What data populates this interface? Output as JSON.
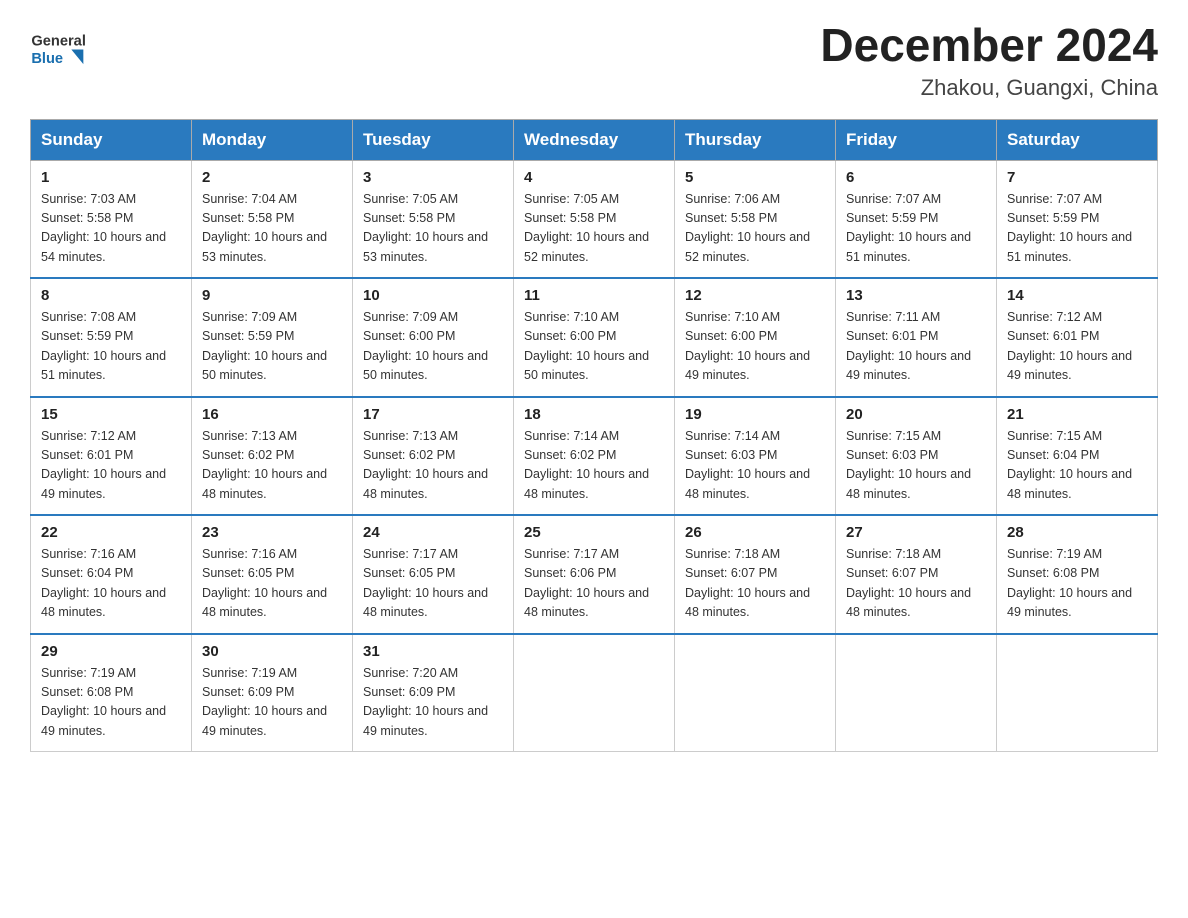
{
  "header": {
    "logo_general": "General",
    "logo_blue": "Blue",
    "month_year": "December 2024",
    "location": "Zhakou, Guangxi, China"
  },
  "weekdays": [
    "Sunday",
    "Monday",
    "Tuesday",
    "Wednesday",
    "Thursday",
    "Friday",
    "Saturday"
  ],
  "weeks": [
    [
      {
        "day": "1",
        "sunrise": "7:03 AM",
        "sunset": "5:58 PM",
        "daylight": "10 hours and 54 minutes."
      },
      {
        "day": "2",
        "sunrise": "7:04 AM",
        "sunset": "5:58 PM",
        "daylight": "10 hours and 53 minutes."
      },
      {
        "day": "3",
        "sunrise": "7:05 AM",
        "sunset": "5:58 PM",
        "daylight": "10 hours and 53 minutes."
      },
      {
        "day": "4",
        "sunrise": "7:05 AM",
        "sunset": "5:58 PM",
        "daylight": "10 hours and 52 minutes."
      },
      {
        "day": "5",
        "sunrise": "7:06 AM",
        "sunset": "5:58 PM",
        "daylight": "10 hours and 52 minutes."
      },
      {
        "day": "6",
        "sunrise": "7:07 AM",
        "sunset": "5:59 PM",
        "daylight": "10 hours and 51 minutes."
      },
      {
        "day": "7",
        "sunrise": "7:07 AM",
        "sunset": "5:59 PM",
        "daylight": "10 hours and 51 minutes."
      }
    ],
    [
      {
        "day": "8",
        "sunrise": "7:08 AM",
        "sunset": "5:59 PM",
        "daylight": "10 hours and 51 minutes."
      },
      {
        "day": "9",
        "sunrise": "7:09 AM",
        "sunset": "5:59 PM",
        "daylight": "10 hours and 50 minutes."
      },
      {
        "day": "10",
        "sunrise": "7:09 AM",
        "sunset": "6:00 PM",
        "daylight": "10 hours and 50 minutes."
      },
      {
        "day": "11",
        "sunrise": "7:10 AM",
        "sunset": "6:00 PM",
        "daylight": "10 hours and 50 minutes."
      },
      {
        "day": "12",
        "sunrise": "7:10 AM",
        "sunset": "6:00 PM",
        "daylight": "10 hours and 49 minutes."
      },
      {
        "day": "13",
        "sunrise": "7:11 AM",
        "sunset": "6:01 PM",
        "daylight": "10 hours and 49 minutes."
      },
      {
        "day": "14",
        "sunrise": "7:12 AM",
        "sunset": "6:01 PM",
        "daylight": "10 hours and 49 minutes."
      }
    ],
    [
      {
        "day": "15",
        "sunrise": "7:12 AM",
        "sunset": "6:01 PM",
        "daylight": "10 hours and 49 minutes."
      },
      {
        "day": "16",
        "sunrise": "7:13 AM",
        "sunset": "6:02 PM",
        "daylight": "10 hours and 48 minutes."
      },
      {
        "day": "17",
        "sunrise": "7:13 AM",
        "sunset": "6:02 PM",
        "daylight": "10 hours and 48 minutes."
      },
      {
        "day": "18",
        "sunrise": "7:14 AM",
        "sunset": "6:02 PM",
        "daylight": "10 hours and 48 minutes."
      },
      {
        "day": "19",
        "sunrise": "7:14 AM",
        "sunset": "6:03 PM",
        "daylight": "10 hours and 48 minutes."
      },
      {
        "day": "20",
        "sunrise": "7:15 AM",
        "sunset": "6:03 PM",
        "daylight": "10 hours and 48 minutes."
      },
      {
        "day": "21",
        "sunrise": "7:15 AM",
        "sunset": "6:04 PM",
        "daylight": "10 hours and 48 minutes."
      }
    ],
    [
      {
        "day": "22",
        "sunrise": "7:16 AM",
        "sunset": "6:04 PM",
        "daylight": "10 hours and 48 minutes."
      },
      {
        "day": "23",
        "sunrise": "7:16 AM",
        "sunset": "6:05 PM",
        "daylight": "10 hours and 48 minutes."
      },
      {
        "day": "24",
        "sunrise": "7:17 AM",
        "sunset": "6:05 PM",
        "daylight": "10 hours and 48 minutes."
      },
      {
        "day": "25",
        "sunrise": "7:17 AM",
        "sunset": "6:06 PM",
        "daylight": "10 hours and 48 minutes."
      },
      {
        "day": "26",
        "sunrise": "7:18 AM",
        "sunset": "6:07 PM",
        "daylight": "10 hours and 48 minutes."
      },
      {
        "day": "27",
        "sunrise": "7:18 AM",
        "sunset": "6:07 PM",
        "daylight": "10 hours and 48 minutes."
      },
      {
        "day": "28",
        "sunrise": "7:19 AM",
        "sunset": "6:08 PM",
        "daylight": "10 hours and 49 minutes."
      }
    ],
    [
      {
        "day": "29",
        "sunrise": "7:19 AM",
        "sunset": "6:08 PM",
        "daylight": "10 hours and 49 minutes."
      },
      {
        "day": "30",
        "sunrise": "7:19 AM",
        "sunset": "6:09 PM",
        "daylight": "10 hours and 49 minutes."
      },
      {
        "day": "31",
        "sunrise": "7:20 AM",
        "sunset": "6:09 PM",
        "daylight": "10 hours and 49 minutes."
      },
      null,
      null,
      null,
      null
    ]
  ]
}
